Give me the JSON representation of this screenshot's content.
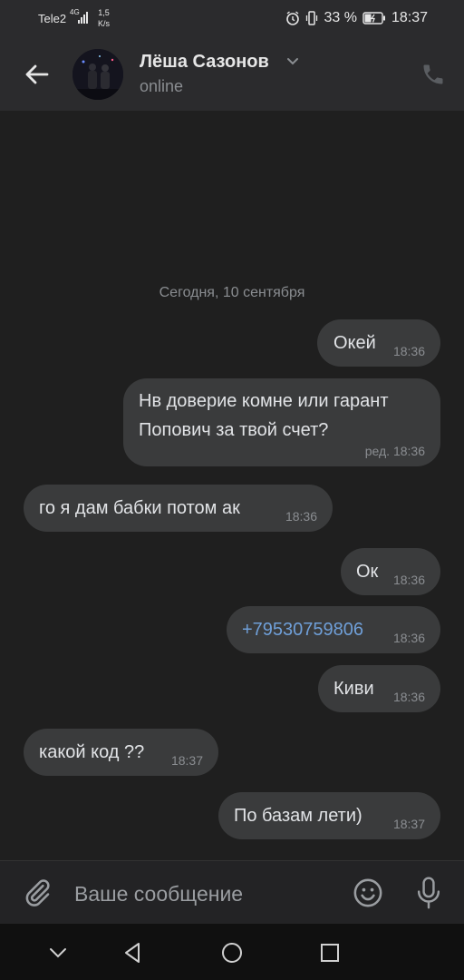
{
  "status_bar": {
    "carrier": "Tele2",
    "network": "4G",
    "speed_value": "1,5",
    "speed_unit": "K/s",
    "battery": "33 %",
    "time": "18:37"
  },
  "header": {
    "contact_name": "Лёша Сазонов",
    "status": "online"
  },
  "chat": {
    "date_separator": "Сегодня, 10 сентября",
    "messages": [
      {
        "direction": "out",
        "text": "Окей",
        "time": "18:36"
      },
      {
        "direction": "out",
        "text": "Нв доверие комне или гарант Попович за твой счет?",
        "time": "ред. 18:36"
      },
      {
        "direction": "in",
        "text": "го я дам бабки потом ак",
        "time": "18:36"
      },
      {
        "direction": "out",
        "text": "Ок",
        "time": "18:36"
      },
      {
        "direction": "out",
        "text": "+79530759806",
        "time": "18:36"
      },
      {
        "direction": "out",
        "text": "Киви",
        "time": "18:36"
      },
      {
        "direction": "in",
        "text": "какой код ??",
        "time": "18:37"
      },
      {
        "direction": "out",
        "text": "По базам лети)",
        "time": "18:37"
      }
    ]
  },
  "composer": {
    "placeholder": "Ваше сообщение"
  },
  "colors": {
    "background": "#1f1f1f",
    "header": "#2b2b2d",
    "bubble": "#3a3b3c",
    "link": "#6f9fd8",
    "muted": "#8a8d91"
  }
}
